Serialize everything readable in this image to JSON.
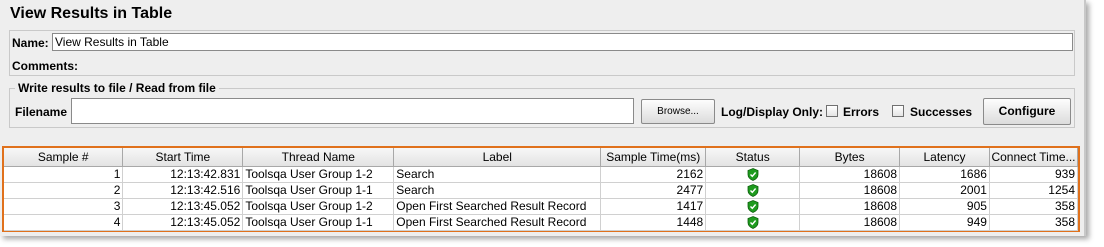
{
  "window": {
    "title": "View Results in Table"
  },
  "name_field": {
    "label": "Name:",
    "value": "View Results in Table"
  },
  "comments": {
    "label": "Comments:"
  },
  "file_section": {
    "legend": "Write results to file / Read from file",
    "filename_label": "Filename",
    "filename_value": "",
    "browse_label": "Browse...",
    "log_display_label": "Log/Display Only:",
    "errors_label": "Errors",
    "errors_checked": false,
    "successes_label": "Successes",
    "successes_checked": false,
    "configure_label": "Configure"
  },
  "table": {
    "columns": [
      "Sample #",
      "Start Time",
      "Thread Name",
      "Label",
      "Sample Time(ms)",
      "Status",
      "Bytes",
      "Latency",
      "Connect Time..."
    ],
    "rows": [
      {
        "sample": "1",
        "start_time": "12:13:42.831",
        "thread": "Toolsqa User Group 1-2",
        "label": "Search",
        "sample_time": "2162",
        "status": "success-icon",
        "bytes": "18608",
        "latency": "1686",
        "connect": "939"
      },
      {
        "sample": "2",
        "start_time": "12:13:42.516",
        "thread": "Toolsqa User Group 1-1",
        "label": "Search",
        "sample_time": "2477",
        "status": "success-icon",
        "bytes": "18608",
        "latency": "2001",
        "connect": "1254"
      },
      {
        "sample": "3",
        "start_time": "12:13:45.052",
        "thread": "Toolsqa User Group 1-2",
        "label": "Open First Searched Result Record",
        "sample_time": "1417",
        "status": "success-icon",
        "bytes": "18608",
        "latency": "905",
        "connect": "358"
      },
      {
        "sample": "4",
        "start_time": "12:13:45.052",
        "thread": "Toolsqa User Group 1-1",
        "label": "Open First Searched Result Record",
        "sample_time": "1448",
        "status": "success-icon",
        "bytes": "18608",
        "latency": "949",
        "connect": "358"
      }
    ]
  },
  "colors": {
    "highlight_border": "#e0711c",
    "status_success": "#1e9b1e"
  }
}
